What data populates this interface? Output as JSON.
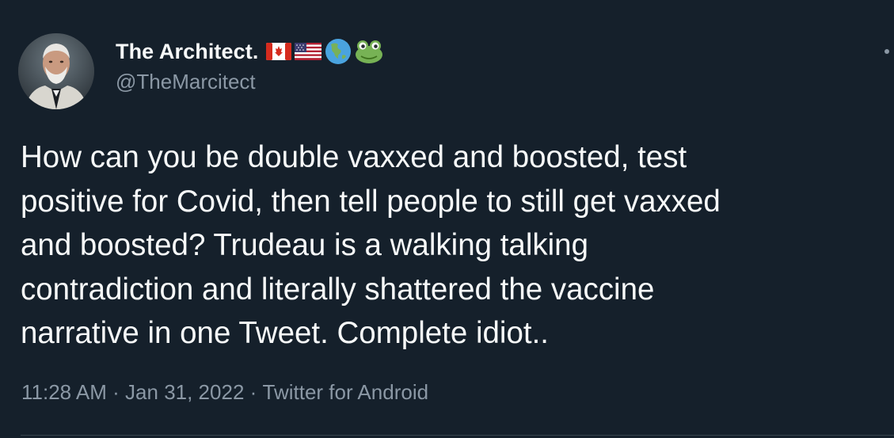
{
  "user": {
    "display_name": "The Architect.",
    "handle": "@TheMarcitect",
    "name_emojis": [
      "canada-flag-icon",
      "usa-flag-icon",
      "globe-americas-icon",
      "frog-icon"
    ]
  },
  "tweet": {
    "text": "How can you be double vaxxed and boosted, test\npositive for Covid, then tell people to still get vaxxed\nand boosted? Trudeau is a walking talking\ncontradiction and literally shattered the vaccine\nnarrative in one Tweet. Complete idiot..",
    "time": "11:28 AM",
    "separator": " · ",
    "date": "Jan 31, 2022",
    "source": "Twitter for Android"
  },
  "colors": {
    "background": "#15202b",
    "primary_text": "#f7f9f9",
    "secondary_text": "#8b98a5",
    "divider": "#38444d"
  }
}
